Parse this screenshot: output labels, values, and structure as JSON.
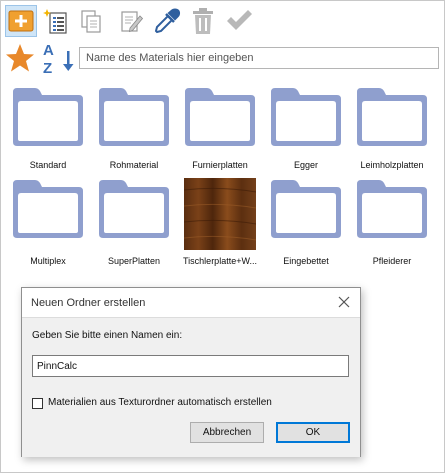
{
  "toolbar": {
    "items": [
      {
        "name": "new-folder-icon",
        "active": true
      },
      {
        "name": "new-material-list-icon",
        "active": false
      },
      {
        "name": "copy-icon",
        "active": false
      },
      {
        "name": "edit-icon",
        "active": false
      },
      {
        "name": "eyedropper-icon",
        "active": false
      },
      {
        "name": "trash-icon",
        "active": false
      },
      {
        "name": "checkmark-icon",
        "active": false
      }
    ]
  },
  "search": {
    "placeholder": "Name des Materials hier eingeben",
    "value": ""
  },
  "sort": {
    "letter_top": "A",
    "letter_bottom": "Z"
  },
  "colors": {
    "folder": "#8f9fce",
    "folder_dark": "#7a8bbd",
    "accent_star": "#e8882a",
    "selected_bg": "#cfe5f7",
    "sort_blue": "#3b6fb6"
  },
  "materials": [
    {
      "label": "Standard",
      "kind": "folder"
    },
    {
      "label": "Rohmaterial",
      "kind": "folder"
    },
    {
      "label": "Furnierplatten",
      "kind": "folder"
    },
    {
      "label": "Egger",
      "kind": "folder"
    },
    {
      "label": "Leimholzplatten",
      "kind": "folder"
    },
    {
      "label": "Multiplex",
      "kind": "folder"
    },
    {
      "label": "SuperPlatten",
      "kind": "folder"
    },
    {
      "label": "Tischlerplatte+W...",
      "kind": "texture"
    },
    {
      "label": "Eingebettet",
      "kind": "folder"
    },
    {
      "label": "Pfleiderer",
      "kind": "folder"
    }
  ],
  "dialog": {
    "title": "Neuen Ordner erstellen",
    "prompt": "Geben Sie bitte einen Namen ein:",
    "input_value": "PinnCalc",
    "checkbox_label": "Materialien aus Texturordner automatisch erstellen",
    "checkbox_checked": false,
    "cancel_label": "Abbrechen",
    "ok_label": "OK"
  }
}
